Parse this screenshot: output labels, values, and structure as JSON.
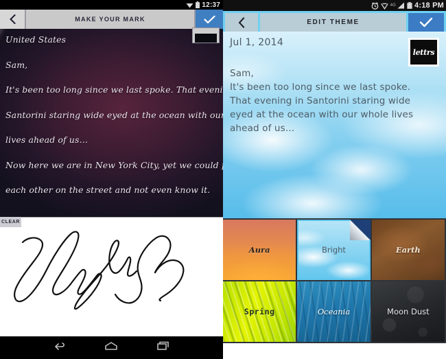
{
  "left_screen": {
    "status_bar": {
      "time": "12:37",
      "icons": [
        "wifi-icon",
        "battery-icon"
      ]
    },
    "header": {
      "back_label": "‹",
      "title": "MAKE YOUR MARK",
      "confirm_label": "check-icon"
    },
    "letter": {
      "lines": [
        "United States",
        "",
        "Sam,",
        "It's been too long since we last spoke. That evening in",
        "Santorini staring wide eyed at the ocean with our whole",
        "lives ahead of us…",
        "Now here we are in New York City, yet we could pass",
        "each other on the street and not even know it."
      ]
    },
    "signature_pad": {
      "clear_label": "CLEAR",
      "signature_text": "Layla"
    },
    "nav_bar": {
      "items": [
        "back-icon",
        "home-icon",
        "recents-icon"
      ]
    }
  },
  "right_screen": {
    "status_bar": {
      "time": "4:18 PM",
      "network": "4G",
      "icons": [
        "alarm-icon",
        "wifi-icon",
        "signal-icon",
        "battery-icon"
      ]
    },
    "header": {
      "back_label": "‹",
      "title": "EDIT THEME",
      "confirm_label": "check-icon"
    },
    "letter": {
      "date": "Jul 1, 2014",
      "stamp_text": "lettrs",
      "lines": [
        "Sam,",
        "It's been too long since we last spoke.",
        "That evening in Santorini staring wide",
        "eyed at the ocean with our whole lives",
        "ahead of us…"
      ]
    },
    "theme_grid": {
      "selected": "Bright",
      "tiles": [
        {
          "name": "Aura",
          "style": "bg-aura",
          "selected": false
        },
        {
          "name": "Bright",
          "style": "bg-bright",
          "selected": true
        },
        {
          "name": "Earth",
          "style": "bg-earth",
          "selected": false
        },
        {
          "name": "Spring",
          "style": "bg-spring",
          "selected": false
        },
        {
          "name": "Oceania",
          "style": "bg-oceania",
          "selected": false
        },
        {
          "name": "Moon Dust",
          "style": "bg-moondust",
          "selected": false
        }
      ]
    }
  },
  "colors": {
    "accent_blue": "#3b7cc4",
    "sky_blue": "#6fd0f2",
    "header_gray": "#b9cdd6",
    "grid_bg": "#2f3338"
  }
}
